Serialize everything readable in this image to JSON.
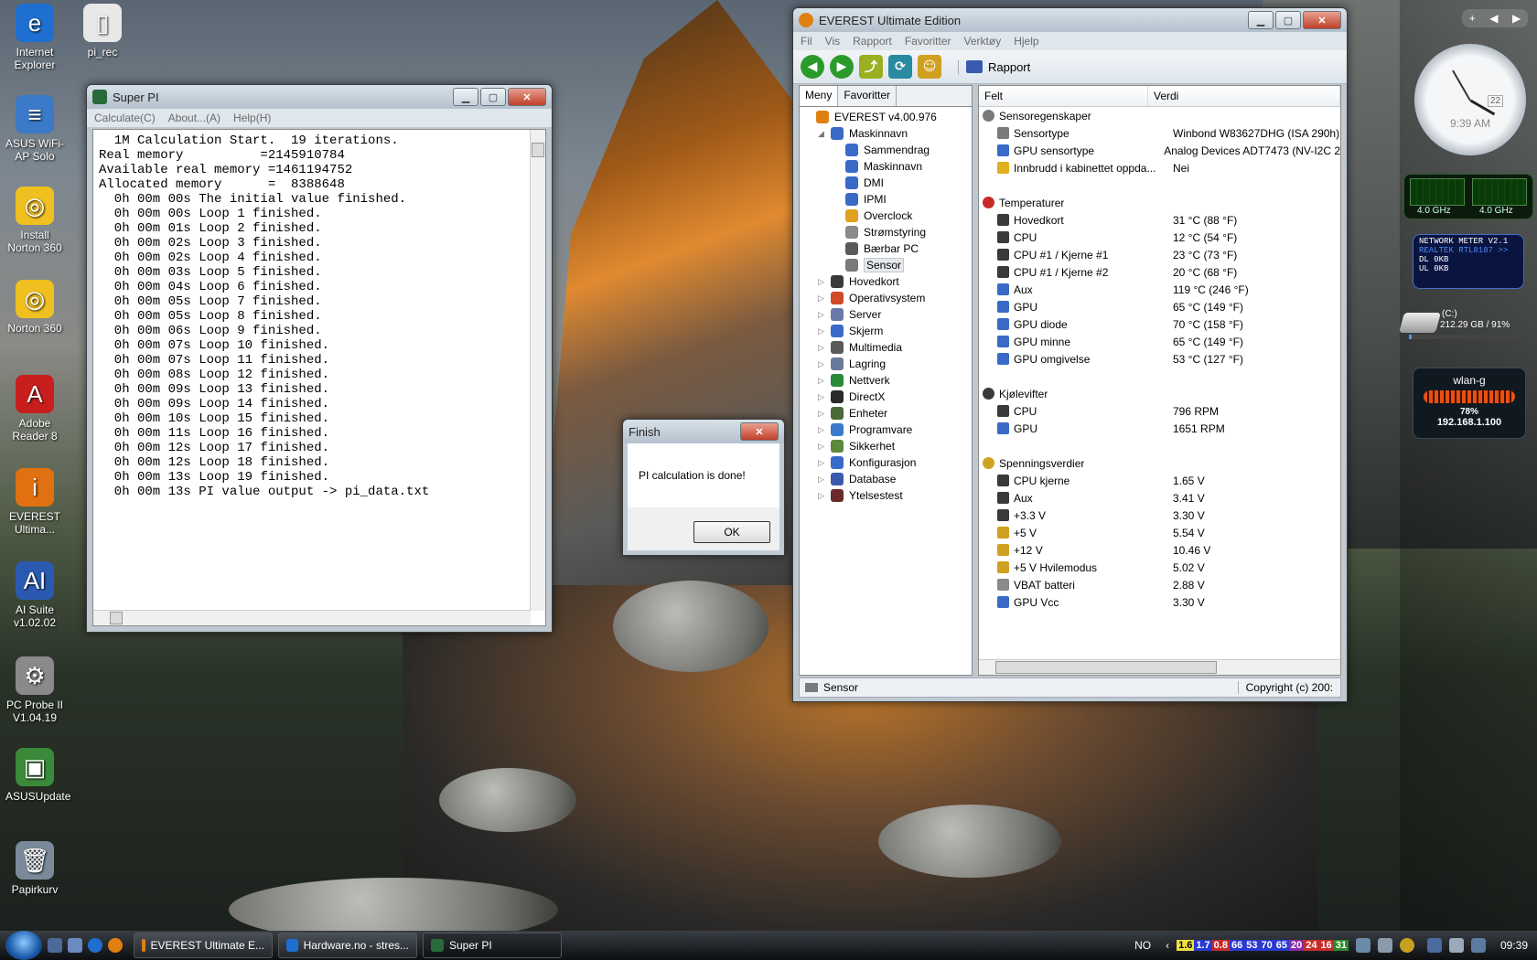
{
  "desktop": {
    "icons": [
      {
        "label": "Internet Explorer",
        "glyph": "e",
        "color": "#1e6fd0"
      },
      {
        "label": "pi_rec",
        "glyph": "▯",
        "color": "#e8e8e8"
      },
      {
        "label": "ASUS WiFi-AP Solo",
        "glyph": "≡",
        "color": "#3a7ac8"
      },
      {
        "label": "Install Norton 360",
        "glyph": "◎",
        "color": "#f0c020"
      },
      {
        "label": "Norton 360",
        "glyph": "◎",
        "color": "#f0c020"
      },
      {
        "label": "Adobe Reader 8",
        "glyph": "A",
        "color": "#c81e1e"
      },
      {
        "label": "EVEREST Ultima...",
        "glyph": "i",
        "color": "#e07010"
      },
      {
        "label": "AI Suite v1.02.02",
        "glyph": "AI",
        "color": "#2a5ab0"
      },
      {
        "label": "PC Probe II V1.04.19",
        "glyph": "⚙",
        "color": "#8a8a8a"
      },
      {
        "label": "ASUSUpdate",
        "glyph": "▣",
        "color": "#3a8a3a"
      },
      {
        "label": "Papirkurv",
        "glyph": "🗑",
        "color": "#7a8a9a"
      }
    ]
  },
  "superpi": {
    "title": "Super PI",
    "menu": [
      "Calculate(C)",
      "About...(A)",
      "Help(H)"
    ],
    "output": "  1M Calculation Start.  19 iterations.\nReal memory          =2145910784\nAvailable real memory =1461194752\nAllocated memory      =  8388648\n  0h 00m 00s The initial value finished.\n  0h 00m 00s Loop 1 finished.\n  0h 00m 01s Loop 2 finished.\n  0h 00m 02s Loop 3 finished.\n  0h 00m 02s Loop 4 finished.\n  0h 00m 03s Loop 5 finished.\n  0h 00m 04s Loop 6 finished.\n  0h 00m 05s Loop 7 finished.\n  0h 00m 05s Loop 8 finished.\n  0h 00m 06s Loop 9 finished.\n  0h 00m 07s Loop 10 finished.\n  0h 00m 07s Loop 11 finished.\n  0h 00m 08s Loop 12 finished.\n  0h 00m 09s Loop 13 finished.\n  0h 00m 09s Loop 14 finished.\n  0h 00m 10s Loop 15 finished.\n  0h 00m 11s Loop 16 finished.\n  0h 00m 12s Loop 17 finished.\n  0h 00m 12s Loop 18 finished.\n  0h 00m 13s Loop 19 finished.\n  0h 00m 13s PI value output -> pi_data.txt"
  },
  "finish": {
    "title": "Finish",
    "message": "PI calculation is done!",
    "ok_label": "OK"
  },
  "everest": {
    "title": "EVEREST Ultimate Edition",
    "menu": [
      "Fil",
      "Vis",
      "Rapport",
      "Favoritter",
      "Verktøy",
      "Hjelp"
    ],
    "toolbar_rapport": "Rapport",
    "tabs": [
      "Meny",
      "Favoritter"
    ],
    "tree": [
      {
        "label": "EVEREST v4.00.976",
        "level": 0,
        "exp": "",
        "color": "#e08010"
      },
      {
        "label": "Maskinnavn",
        "level": 1,
        "exp": "◢",
        "color": "#3a6ac8"
      },
      {
        "label": "Sammendrag",
        "level": 2,
        "exp": "",
        "color": "#3a6ac8"
      },
      {
        "label": "Maskinnavn",
        "level": 2,
        "exp": "",
        "color": "#3a6ac8"
      },
      {
        "label": "DMI",
        "level": 2,
        "exp": "",
        "color": "#3a6ac8"
      },
      {
        "label": "IPMI",
        "level": 2,
        "exp": "",
        "color": "#3a6ac8"
      },
      {
        "label": "Overclock",
        "level": 2,
        "exp": "",
        "color": "#e0a020"
      },
      {
        "label": "Strømstyring",
        "level": 2,
        "exp": "",
        "color": "#8a8a8a"
      },
      {
        "label": "Bærbar PC",
        "level": 2,
        "exp": "",
        "color": "#5a5a5a"
      },
      {
        "label": "Sensor",
        "level": 2,
        "exp": "",
        "color": "#7a7a7a",
        "selected": true
      },
      {
        "label": "Hovedkort",
        "level": 1,
        "exp": "▷",
        "color": "#3a3a3a"
      },
      {
        "label": "Operativsystem",
        "level": 1,
        "exp": "▷",
        "color": "#d04a2a"
      },
      {
        "label": "Server",
        "level": 1,
        "exp": "▷",
        "color": "#6a7aa8"
      },
      {
        "label": "Skjerm",
        "level": 1,
        "exp": "▷",
        "color": "#3a6ac8"
      },
      {
        "label": "Multimedia",
        "level": 1,
        "exp": "▷",
        "color": "#5a5a5a"
      },
      {
        "label": "Lagring",
        "level": 1,
        "exp": "▷",
        "color": "#6a7a9a"
      },
      {
        "label": "Nettverk",
        "level": 1,
        "exp": "▷",
        "color": "#2a8a3a"
      },
      {
        "label": "DirectX",
        "level": 1,
        "exp": "▷",
        "color": "#2a2a2a"
      },
      {
        "label": "Enheter",
        "level": 1,
        "exp": "▷",
        "color": "#4a6a3a"
      },
      {
        "label": "Programvare",
        "level": 1,
        "exp": "▷",
        "color": "#3a7ac8"
      },
      {
        "label": "Sikkerhet",
        "level": 1,
        "exp": "▷",
        "color": "#5a8a3a"
      },
      {
        "label": "Konfigurasjon",
        "level": 1,
        "exp": "▷",
        "color": "#3a6ac8"
      },
      {
        "label": "Database",
        "level": 1,
        "exp": "▷",
        "color": "#3a5ab0"
      },
      {
        "label": "Ytelsestest",
        "level": 1,
        "exp": "▷",
        "color": "#6a2a2a"
      }
    ],
    "columns": [
      "Felt",
      "Verdi"
    ],
    "rows": [
      {
        "type": "group",
        "field": "Sensoregenskaper",
        "color": "#7a7a7a"
      },
      {
        "field": "Sensortype",
        "value": "Winbond W83627DHG  (ISA 290h)",
        "color": "#7a7a7a"
      },
      {
        "field": "GPU sensortype",
        "value": "Analog Devices ADT7473  (NV-I2C 2",
        "color": "#3a6ac8"
      },
      {
        "field": "Innbrudd i kabinettet oppda...",
        "value": "Nei",
        "color": "#e0b020"
      },
      {
        "type": "spacer"
      },
      {
        "type": "group",
        "field": "Temperaturer",
        "color": "#c82a2a"
      },
      {
        "field": "Hovedkort",
        "value": "31 °C  (88 °F)",
        "color": "#3a3a3a"
      },
      {
        "field": "CPU",
        "value": "12 °C  (54 °F)",
        "color": "#3a3a3a"
      },
      {
        "field": "CPU #1 / Kjerne #1",
        "value": "23 °C  (73 °F)",
        "color": "#3a3a3a"
      },
      {
        "field": "CPU #1 / Kjerne #2",
        "value": "20 °C  (68 °F)",
        "color": "#3a3a3a"
      },
      {
        "field": "Aux",
        "value": "119 °C  (246 °F)",
        "color": "#3a6ac8"
      },
      {
        "field": "GPU",
        "value": "65 °C  (149 °F)",
        "color": "#3a6ac8"
      },
      {
        "field": "GPU diode",
        "value": "70 °C  (158 °F)",
        "color": "#3a6ac8"
      },
      {
        "field": "GPU minne",
        "value": "65 °C  (149 °F)",
        "color": "#3a6ac8"
      },
      {
        "field": "GPU omgivelse",
        "value": "53 °C  (127 °F)",
        "color": "#3a6ac8"
      },
      {
        "type": "spacer"
      },
      {
        "type": "group",
        "field": "Kjølevifter",
        "color": "#3a3a3a"
      },
      {
        "field": "CPU",
        "value": "796 RPM",
        "color": "#3a3a3a"
      },
      {
        "field": "GPU",
        "value": "1651 RPM",
        "color": "#3a6ac8"
      },
      {
        "type": "spacer"
      },
      {
        "type": "group",
        "field": "Spenningsverdier",
        "color": "#d0a020"
      },
      {
        "field": "CPU kjerne",
        "value": "1.65 V",
        "color": "#3a3a3a"
      },
      {
        "field": "Aux",
        "value": "3.41 V",
        "color": "#3a3a3a"
      },
      {
        "field": "+3.3 V",
        "value": "3.30 V",
        "color": "#3a3a3a"
      },
      {
        "field": "+5 V",
        "value": "5.54 V",
        "color": "#d0a020"
      },
      {
        "field": "+12 V",
        "value": "10.46 V",
        "color": "#d0a020"
      },
      {
        "field": "+5 V Hvilemodus",
        "value": "5.02 V",
        "color": "#d0a020"
      },
      {
        "field": "VBAT batteri",
        "value": "2.88 V",
        "color": "#8a8a8a"
      },
      {
        "field": "GPU Vcc",
        "value": "3.30 V",
        "color": "#3a6ac8"
      }
    ],
    "status_left": "Sensor",
    "status_right": "Copyright (c) 200:"
  },
  "sidebar": {
    "clock_time": "9:39 AM",
    "clock_day": "22",
    "cpu1": "4.0 GHz",
    "cpu2": "4.0 GHz",
    "netmeter_title": "NETWORK METER V2.1",
    "netmeter_adapter": "REALTEK RTL8187 >>",
    "dl": "DL   0KB",
    "ul": "UL   0KB",
    "drive_label": "(C:)",
    "drive_info": "212.29 GB / 91%",
    "wlan_title": "wlan-g",
    "wlan_pct": "78%",
    "wlan_ip": "192.168.1.100"
  },
  "taskbar": {
    "buttons": [
      {
        "label": "EVEREST Ultimate E...",
        "color": "#e08010"
      },
      {
        "label": "Hardware.no - stres...",
        "color": "#1e6fd0"
      },
      {
        "label": "Super PI",
        "color": "#2a6a3a",
        "active": true
      }
    ],
    "lang": "NO",
    "tray_nums": [
      {
        "t": "1.6",
        "bg": "#f0e040",
        "fg": "#000"
      },
      {
        "t": "1.7",
        "bg": "#2a3ad0",
        "fg": "#fff"
      },
      {
        "t": "0.8",
        "bg": "#c82a2a",
        "fg": "#fff"
      },
      {
        "t": "66",
        "bg": "#2a3ad0",
        "fg": "#fff"
      },
      {
        "t": "53",
        "bg": "#2a3ad0",
        "fg": "#fff"
      },
      {
        "t": "70",
        "bg": "#2a3ad0",
        "fg": "#fff"
      },
      {
        "t": "65",
        "bg": "#2a3ad0",
        "fg": "#fff"
      },
      {
        "t": "20",
        "bg": "#8a2aa8",
        "fg": "#fff"
      },
      {
        "t": "24",
        "bg": "#c82a2a",
        "fg": "#fff"
      },
      {
        "t": "16",
        "bg": "#c82a2a",
        "fg": "#fff"
      },
      {
        "t": "31",
        "bg": "#2a8a2a",
        "fg": "#fff"
      }
    ],
    "clock": "09:39"
  }
}
